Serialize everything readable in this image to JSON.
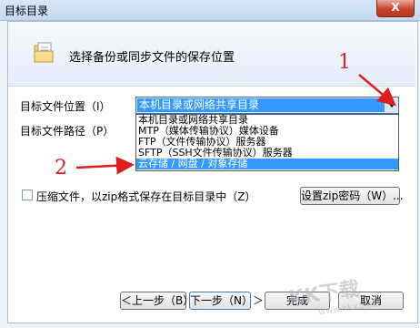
{
  "window": {
    "title": "目标目录",
    "close_label": "X"
  },
  "header": {
    "text": "选择备份或同步文件的保存位置"
  },
  "location": {
    "label": "目标文件位置（I）",
    "selected": "本机目录或网络共享目录",
    "options": [
      "本机目录或网络共享目录",
      "MTP（媒体传输协议）媒体设备",
      "FTP（文件传输协议）服务器",
      "SFTP（SSH文件传输协议）服务器",
      "云存储 / 网盘 / 对象存储"
    ],
    "highlighted_index": 4
  },
  "path": {
    "label": "目标文件路径（P）"
  },
  "compress": {
    "label": "压缩文件，以zip格式保存在目标目录中（Z）",
    "checked": false
  },
  "zip_password_button": "设置zip密码（W）...",
  "footer": {
    "back": "＜上一步（B）",
    "next": "下一步（N）＞",
    "finish": "完成",
    "cancel": "取消"
  },
  "annotations": [
    "1",
    "2"
  ],
  "watermark": {
    "text": "KK下载",
    "url": "www.kkx.net"
  },
  "colors": {
    "highlight": "#3399ff",
    "annotation": "#e21d1d"
  }
}
